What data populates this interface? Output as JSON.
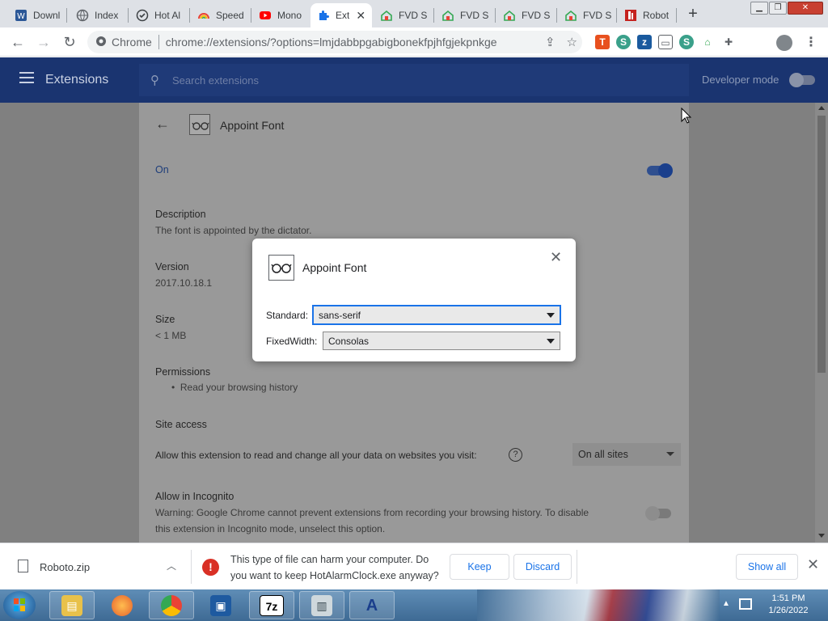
{
  "browser": {
    "tabs": [
      {
        "label": "Downl",
        "icon": "word-doc-icon"
      },
      {
        "label": "Index",
        "icon": "globe-icon"
      },
      {
        "label": "Hot Al",
        "icon": "clock-icon"
      },
      {
        "label": "Speed",
        "icon": "rainbow-icon"
      },
      {
        "label": "Mono",
        "icon": "youtube-icon"
      },
      {
        "label": "Ext",
        "icon": "puzzle-icon",
        "active": true
      },
      {
        "label": "FVD S",
        "icon": "fvd-house-icon"
      },
      {
        "label": "FVD S",
        "icon": "fvd-house-icon"
      },
      {
        "label": "FVD S",
        "icon": "fvd-house-icon"
      },
      {
        "label": "FVD S",
        "icon": "fvd-house-icon"
      },
      {
        "label": "Robot",
        "icon": "font-r-icon"
      }
    ],
    "omnibox": {
      "scheme_label": "Chrome",
      "url": "chrome://extensions/?options=lmjdabbpgabigbonekfpjhfgjekpnkge"
    }
  },
  "extensions_page": {
    "header_title": "Extensions",
    "search_placeholder": "Search extensions",
    "developer_mode_label": "Developer mode",
    "developer_mode_on": false
  },
  "extension_details": {
    "name": "Appoint Font",
    "on_label": "On",
    "enabled": true,
    "description_title": "Description",
    "description": "The font is appointed by the dictator.",
    "version_title": "Version",
    "version": "2017.10.18.1",
    "size_title": "Size",
    "size": "< 1 MB",
    "permissions_title": "Permissions",
    "permissions": [
      "Read your browsing history"
    ],
    "site_access_title": "Site access",
    "site_access_text": "Allow this extension to read and change all your data on websites you visit:",
    "site_access_value": "On all sites",
    "incognito_title": "Allow in Incognito",
    "incognito_text_line1": "Warning: Google Chrome cannot prevent extensions from recording your browsing history. To disable",
    "incognito_text_line2": "this extension in Incognito mode, unselect this option.",
    "incognito_enabled": false
  },
  "options_dialog": {
    "title": "Appoint Font",
    "standard_label": "Standard:",
    "standard_value": "sans-serif",
    "fixedwidth_label": "FixedWidth:",
    "fixedwidth_value": "Consolas"
  },
  "download_bar": {
    "file_name": "Roboto.zip",
    "warning_line1": "This type of file can harm your computer. Do",
    "warning_line2": "you want to keep HotAlarmClock.exe anyway?",
    "keep_label": "Keep",
    "discard_label": "Discard",
    "show_all_label": "Show all"
  },
  "taskbar": {
    "apps": [
      "explorer-icon",
      "firefox-icon",
      "chrome-icon",
      "virtualbox-icon",
      "7zip-icon",
      "monitor-icon",
      "fontforge-icon"
    ],
    "seven_zip_label": "7z",
    "time": "1:51 PM",
    "date": "1/26/2022"
  },
  "colors": {
    "accent_blue": "#1a73e8",
    "header_navy": "#1a3470",
    "warning_red": "#d93025"
  }
}
